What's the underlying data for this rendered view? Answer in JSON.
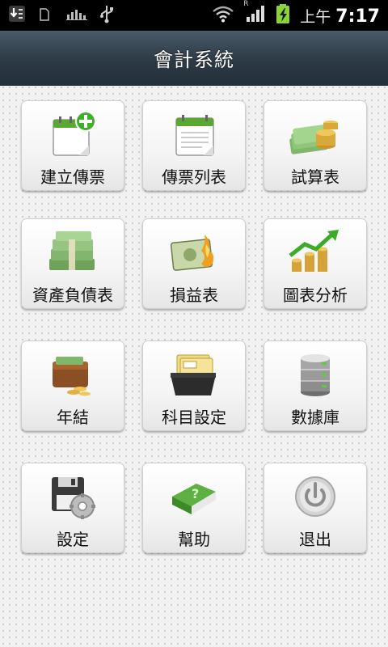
{
  "status_bar": {
    "ampm": "上午",
    "time": "7:17",
    "network_mark": "R",
    "icons": [
      "download-icon",
      "sd-card-icon",
      "signal-bars-icon",
      "usb-icon",
      "wifi-icon",
      "cell-signal-icon",
      "battery-charging-icon"
    ]
  },
  "app": {
    "title": "會計系統"
  },
  "menu": [
    {
      "label": "建立傳票",
      "icon": "calendar-add-icon"
    },
    {
      "label": "傳票列表",
      "icon": "calendar-list-icon"
    },
    {
      "label": "試算表",
      "icon": "money-coins-icon"
    },
    {
      "label": "資產負債表",
      "icon": "money-stacks-icon"
    },
    {
      "label": "損益表",
      "icon": "burning-money-icon"
    },
    {
      "label": "圖表分析",
      "icon": "growth-chart-icon"
    },
    {
      "label": "年結",
      "icon": "wallet-icon"
    },
    {
      "label": "科目設定",
      "icon": "file-box-icon"
    },
    {
      "label": "數據庫",
      "icon": "database-icon"
    },
    {
      "label": "設定",
      "icon": "floppy-gear-icon"
    },
    {
      "label": "幫助",
      "icon": "help-book-icon"
    },
    {
      "label": "退出",
      "icon": "power-icon"
    }
  ]
}
